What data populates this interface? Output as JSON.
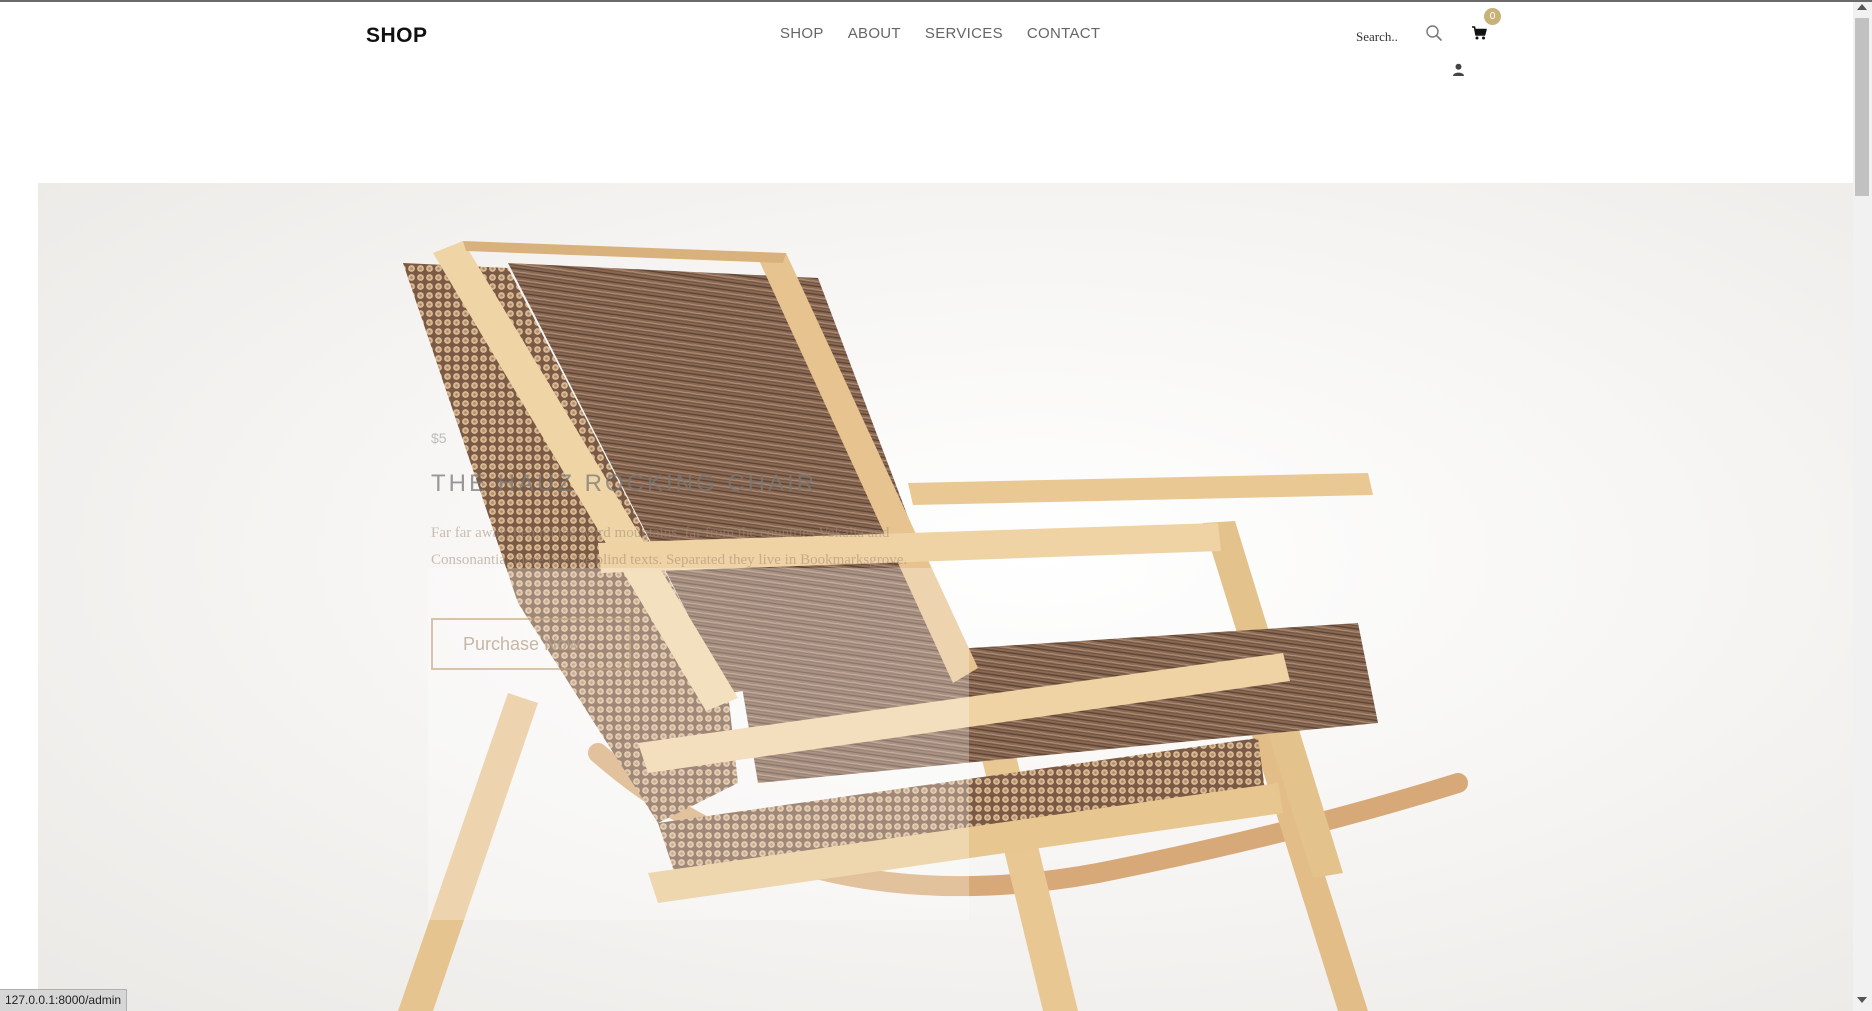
{
  "header": {
    "logo": "SHOP",
    "nav": [
      {
        "label": "SHOP"
      },
      {
        "label": "ABOUT"
      },
      {
        "label": "SERVICES"
      },
      {
        "label": "CONTACT"
      }
    ],
    "search_placeholder": "Search..",
    "cart_count": "0"
  },
  "hero": {
    "price": "$5",
    "title": "THE HAUZ ROCKING CHAIR",
    "description": "Far far away, behind the word mountains, far from the countries Vokalia and Consonantia, there live the blind texts. Separated they live in Bookmarksgrove.",
    "button_label": "Purchase Now"
  },
  "status_bar": {
    "url": "127.0.0.1:8000/admin"
  },
  "colors": {
    "accent": "#c9b27a",
    "nav_text": "#666666",
    "wood": "#e4c08c"
  },
  "icons": {
    "search": "search-icon",
    "cart": "cart-icon",
    "user": "user-icon"
  }
}
